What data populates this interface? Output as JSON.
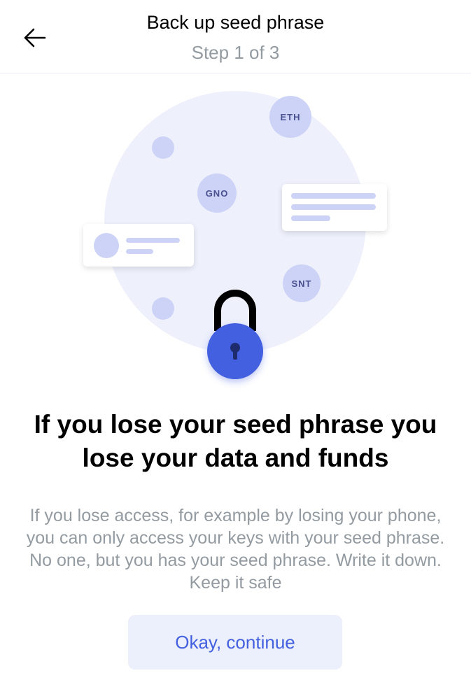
{
  "header": {
    "title": "Back up seed phrase",
    "step": "Step 1 of 3",
    "back_icon": "arrow-left-icon"
  },
  "illustration": {
    "tokens": [
      "ETH",
      "GNO",
      "SNT"
    ],
    "lock_icon": "lock-icon"
  },
  "main": {
    "heading": "If you lose your seed phrase you lose your data and funds",
    "description": "If you lose access, for example by losing your phone, you can only access your keys with your seed phrase. No one, but you has your seed phrase. Write it down. Keep it safe",
    "continue_label": "Okay, continue"
  },
  "colors": {
    "accent": "#4360df",
    "accent_light": "#eceffc",
    "circle_bg": "#eef0fc",
    "token_bg": "#ccd3f6",
    "text_secondary": "#939ba1"
  }
}
